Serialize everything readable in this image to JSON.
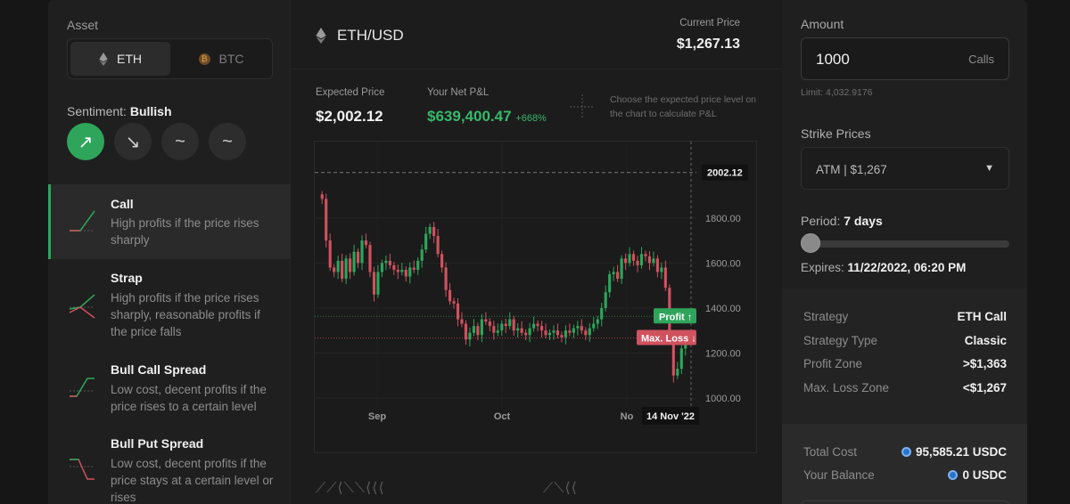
{
  "left": {
    "asset_label": "Asset",
    "assets": [
      {
        "label": "ETH",
        "active": true
      },
      {
        "label": "BTC",
        "active": false
      }
    ],
    "btc_symbol": "₿",
    "sentiment_label": "Sentiment:",
    "sentiment_value": "Bullish",
    "sentiment_buttons": [
      "↗",
      "↘",
      "~",
      "~"
    ],
    "strategies": [
      {
        "title": "Call",
        "desc": "High profits if the price rises sharply",
        "active": true
      },
      {
        "title": "Strap",
        "desc": "High profits if the price rises sharply, reasonable profits if the price falls",
        "active": false
      },
      {
        "title": "Bull Call Spread",
        "desc": "Low cost, decent profits if the price rises to a certain level",
        "active": false
      },
      {
        "title": "Bull Put Spread",
        "desc": "Low cost, decent profits if the price stays at a certain level or rises",
        "active": false
      }
    ]
  },
  "center": {
    "pair": "ETH/USD",
    "current_price_label": "Current Price",
    "current_price": "$1,267.13",
    "expected_price_label": "Expected Price",
    "expected_price": "$2,002.12",
    "pnl_label": "Your Net P&L",
    "pnl_value": "$639,400.47",
    "pnl_pct": "+668%",
    "hint": "Choose the expected price level on the chart to calculate P&L",
    "bottom_icons": "⟋⟋⟨⟍⟍⟨⟨⟨",
    "bottom_icons2": "⟋⟍⟨⟨"
  },
  "chart_data": {
    "type": "candlestick",
    "ylim": [
      1000,
      2100
    ],
    "y_ticks": [
      "1000.00",
      "1200.00",
      "1400.00",
      "1600.00",
      "1800.00"
    ],
    "x_labels": [
      "Sep",
      "Oct",
      "No"
    ],
    "expected_price_label": "2002.12",
    "profit_label": "Profit ↑",
    "profit_level": 1363,
    "loss_label": "Max. Loss ↓",
    "loss_level": 1267,
    "crosshair_date": "14 Nov '22",
    "colors": {
      "up": "#2fa55b",
      "down": "#d0525f"
    },
    "closes": [
      1885,
      1700,
      1580,
      1560,
      1610,
      1530,
      1620,
      1560,
      1650,
      1600,
      1700,
      1680,
      1560,
      1460,
      1560,
      1600,
      1610,
      1590,
      1570,
      1560,
      1570,
      1540,
      1580,
      1570,
      1610,
      1660,
      1730,
      1760,
      1720,
      1640,
      1580,
      1480,
      1430,
      1420,
      1350,
      1330,
      1260,
      1290,
      1320,
      1280,
      1350,
      1340,
      1320,
      1290,
      1300,
      1330,
      1320,
      1350,
      1300,
      1310,
      1290,
      1280,
      1310,
      1330,
      1320,
      1300,
      1280,
      1290,
      1300,
      1280,
      1270,
      1300,
      1290,
      1310,
      1320,
      1300,
      1280,
      1310,
      1330,
      1350,
      1400,
      1470,
      1550,
      1560,
      1530,
      1620,
      1600,
      1640,
      1610,
      1590,
      1640,
      1630,
      1600,
      1620,
      1560,
      1580,
      1490,
      1260,
      1100,
      1130,
      1220,
      1260
    ]
  },
  "right": {
    "amount_label": "Amount",
    "amount_value": "1000",
    "amount_unit": "Calls",
    "limit": "Limit: 4,032.9176",
    "strike_label": "Strike Prices",
    "strike_value": "ATM  |  $1,267",
    "period_label": "Period:",
    "period_value": "7 days",
    "period_fraction": 0.0,
    "expires_label": "Expires:",
    "expires_value": "11/22/2022, 06:20 PM",
    "summary": [
      {
        "k": "Strategy",
        "v": "ETH Call"
      },
      {
        "k": "Strategy Type",
        "v": "Classic"
      },
      {
        "k": "Profit Zone",
        "v": ">$1,363"
      },
      {
        "k": "Max. Loss Zone",
        "v": "<$1,267"
      }
    ],
    "cost": [
      {
        "k": "Total Cost",
        "v": "95,585.21 USDC"
      },
      {
        "k": "Your Balance",
        "v": "0 USDC"
      }
    ]
  }
}
